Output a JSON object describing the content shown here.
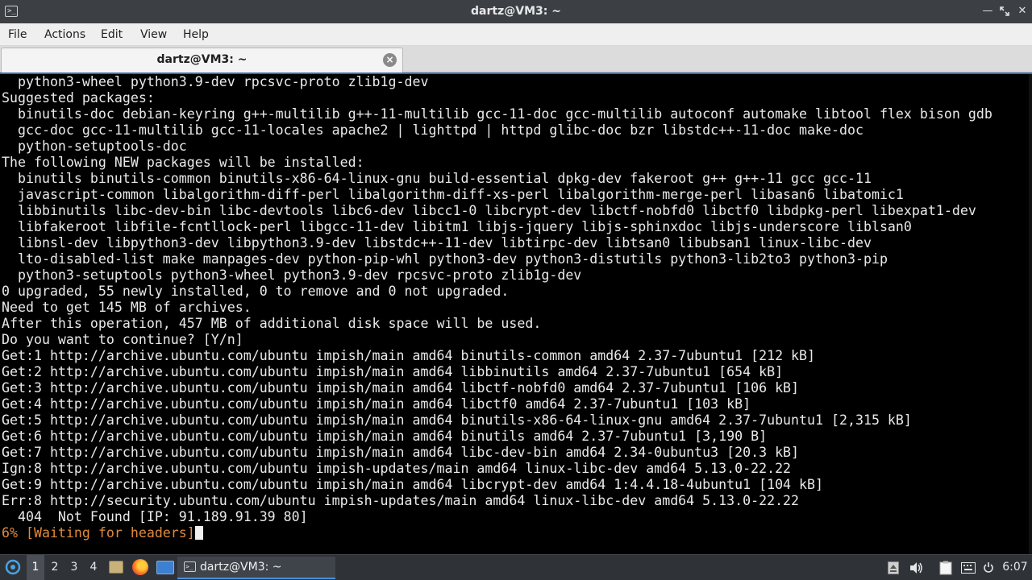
{
  "window": {
    "title": "dartz@VM3: ~",
    "icon": "terminal-icon",
    "controls": [
      "minimize-icon",
      "maximize-icon",
      "close-icon"
    ]
  },
  "menu": [
    "File",
    "Actions",
    "Edit",
    "View",
    "Help"
  ],
  "tab": {
    "label": "dartz@VM3: ~",
    "close_glyph": "×"
  },
  "terminal": {
    "lines": [
      "  python3-wheel python3.9-dev rpcsvc-proto zlib1g-dev",
      "Suggested packages:",
      "  binutils-doc debian-keyring g++-multilib g++-11-multilib gcc-11-doc gcc-multilib autoconf automake libtool flex bison gdb",
      "  gcc-doc gcc-11-multilib gcc-11-locales apache2 | lighttpd | httpd glibc-doc bzr libstdc++-11-doc make-doc",
      "  python-setuptools-doc",
      "The following NEW packages will be installed:",
      "  binutils binutils-common binutils-x86-64-linux-gnu build-essential dpkg-dev fakeroot g++ g++-11 gcc gcc-11",
      "  javascript-common libalgorithm-diff-perl libalgorithm-diff-xs-perl libalgorithm-merge-perl libasan6 libatomic1",
      "  libbinutils libc-dev-bin libc-devtools libc6-dev libcc1-0 libcrypt-dev libctf-nobfd0 libctf0 libdpkg-perl libexpat1-dev",
      "  libfakeroot libfile-fcntllock-perl libgcc-11-dev libitm1 libjs-jquery libjs-sphinxdoc libjs-underscore liblsan0",
      "  libnsl-dev libpython3-dev libpython3.9-dev libstdc++-11-dev libtirpc-dev libtsan0 libubsan1 linux-libc-dev",
      "  lto-disabled-list make manpages-dev python-pip-whl python3-dev python3-distutils python3-lib2to3 python3-pip",
      "  python3-setuptools python3-wheel python3.9-dev rpcsvc-proto zlib1g-dev",
      "0 upgraded, 55 newly installed, 0 to remove and 0 not upgraded.",
      "Need to get 145 MB of archives.",
      "After this operation, 457 MB of additional disk space will be used.",
      "Do you want to continue? [Y/n]",
      "Get:1 http://archive.ubuntu.com/ubuntu impish/main amd64 binutils-common amd64 2.37-7ubuntu1 [212 kB]",
      "Get:2 http://archive.ubuntu.com/ubuntu impish/main amd64 libbinutils amd64 2.37-7ubuntu1 [654 kB]",
      "Get:3 http://archive.ubuntu.com/ubuntu impish/main amd64 libctf-nobfd0 amd64 2.37-7ubuntu1 [106 kB]",
      "Get:4 http://archive.ubuntu.com/ubuntu impish/main amd64 libctf0 amd64 2.37-7ubuntu1 [103 kB]",
      "Get:5 http://archive.ubuntu.com/ubuntu impish/main amd64 binutils-x86-64-linux-gnu amd64 2.37-7ubuntu1 [2,315 kB]",
      "Get:6 http://archive.ubuntu.com/ubuntu impish/main amd64 binutils amd64 2.37-7ubuntu1 [3,190 B]",
      "Get:7 http://archive.ubuntu.com/ubuntu impish/main amd64 libc-dev-bin amd64 2.34-0ubuntu3 [20.3 kB]",
      "Ign:8 http://archive.ubuntu.com/ubuntu impish-updates/main amd64 linux-libc-dev amd64 5.13.0-22.22",
      "Get:9 http://archive.ubuntu.com/ubuntu impish/main amd64 libcrypt-dev amd64 1:4.4.18-4ubuntu1 [104 kB]",
      "Err:8 http://security.ubuntu.com/ubuntu impish-updates/main amd64 linux-libc-dev amd64 5.13.0-22.22",
      "  404  Not Found [IP: 91.189.91.39 80]"
    ],
    "progress_line": "6% [Waiting for headers]",
    "progress_color": "#e08a3c"
  },
  "taskbar": {
    "workspaces": [
      "1",
      "2",
      "3",
      "4"
    ],
    "active_workspace": "1",
    "task_label": "dartz@VM3: ~",
    "clock": "6:07",
    "icons": [
      "start-menu-icon",
      "files-icon",
      "firefox-icon",
      "desktop-icon",
      "terminal-icon",
      "eject-icon",
      "volume-icon",
      "clipboard-icon",
      "keyboard-icon",
      "power-icon"
    ]
  }
}
